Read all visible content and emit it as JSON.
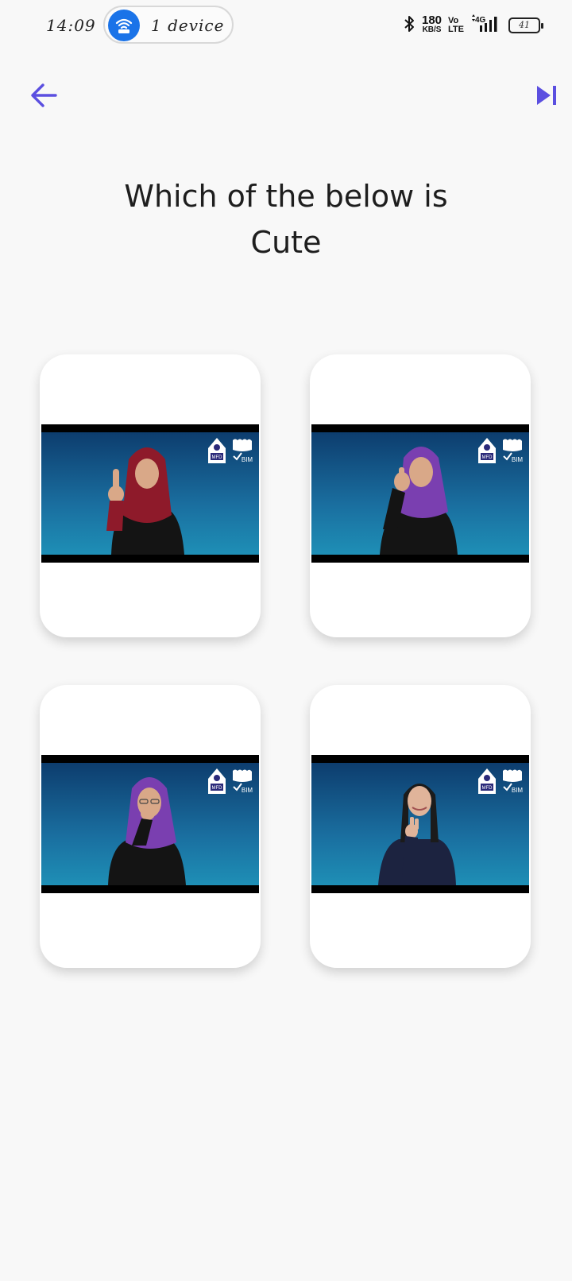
{
  "status_bar": {
    "time": "14:09",
    "hotspot_label": "1 device",
    "net_speed_value": "180",
    "net_speed_unit": "KB/S",
    "volte_top": "Vo",
    "volte_bottom": "LTE",
    "network_type": "4G",
    "battery_level": "41"
  },
  "quiz": {
    "question_line1": "Which of the below is",
    "question_line2": "Cute",
    "options": [
      {
        "id": "option-1",
        "headscarf_color": "#8e1a2a",
        "clothes_color": "#141414",
        "has_hijab": true
      },
      {
        "id": "option-2",
        "headscarf_color": "#7a3fb0",
        "clothes_color": "#141414",
        "has_hijab": true
      },
      {
        "id": "option-3",
        "headscarf_color": "#7a3fb0",
        "clothes_color": "#141414",
        "has_hijab": true
      },
      {
        "id": "option-4",
        "headscarf_color": "#1b1b1b",
        "clothes_color": "#1c2340",
        "has_hijab": false
      }
    ]
  },
  "video_logos": {
    "left": "MFD",
    "right": "BIM"
  },
  "colors": {
    "accent": "#5b4fe0",
    "background": "#f8f8f8"
  }
}
